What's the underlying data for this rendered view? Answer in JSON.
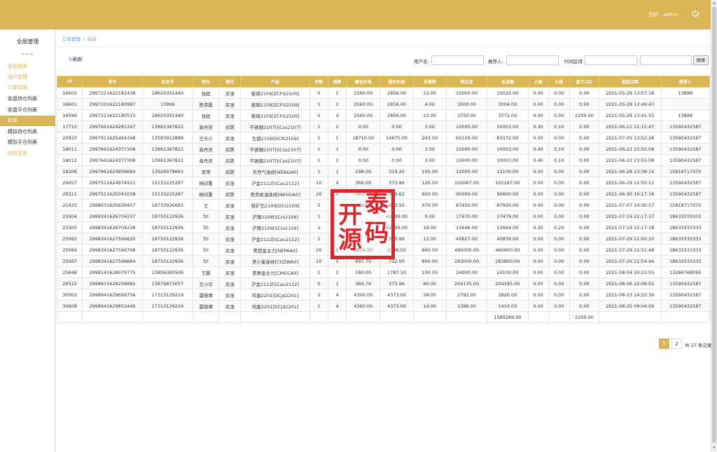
{
  "header": {
    "welcome": "您好：admin",
    "power_icon": "power-icon"
  },
  "sidebar": {
    "title": "全局管理",
    "items": [
      {
        "label": "系统相关",
        "kind": "section"
      },
      {
        "label": "客户管理",
        "kind": "section"
      },
      {
        "label": "订单管理",
        "kind": "section"
      },
      {
        "label": "实盘持仓列表",
        "kind": "sub"
      },
      {
        "label": "实盘平仓列表",
        "kind": "sub"
      },
      {
        "label": "挂单",
        "kind": "active"
      },
      {
        "label": "模拟持仓列表",
        "kind": "sub"
      },
      {
        "label": "模拟平仓列表",
        "kind": "sub"
      },
      {
        "label": "财务管理",
        "kind": "section"
      }
    ]
  },
  "breadcrumb": {
    "parent": "订单管理",
    "separator": "/",
    "current": "挂单"
  },
  "toolbar": {
    "refresh_label": "刷新",
    "username_label": "用户名:",
    "referrer_label": "推荐人:",
    "time_range_label": "时间区域",
    "range_dash": "-",
    "search_label": "搜索"
  },
  "table": {
    "columns": [
      "ID",
      "单号",
      "会员号",
      "姓名",
      "模式",
      "产品",
      "手数",
      "倍数",
      "建仓价格",
      "报价价格",
      "手续费",
      "保证金",
      "总金额",
      "止盈",
      "止损",
      "盈亏(点)",
      "发起日期",
      "推荐人"
    ],
    "rows": [
      [
        "16602",
        "2997221622181438",
        "18620331440",
        "张超",
        "买涨",
        "玻璃2109[ZCFG2109]",
        "5",
        "1",
        "2560.00",
        "2856.00",
        "22.00",
        "15000.00",
        "15022.00",
        "0.00",
        "0.00",
        "0.00",
        "2021-05-28 13:57:18",
        "13888"
      ],
      [
        "16601",
        "2997201622180987",
        "13999",
        "陈伟霞",
        "买涨",
        "玻璃2109[ZCFG2109]",
        "1",
        "1",
        "2560.00",
        "2856.00",
        "4.00",
        "3000.00",
        "3004.00",
        "0.00",
        "0.00",
        "0.00",
        "2021-05-28 13:49:47",
        ""
      ],
      [
        "16599",
        "2997221622180515",
        "18620331440",
        "张超",
        "买涨",
        "玻璃2109[ZCFG2109]",
        "5",
        "4",
        "2560.00",
        "2856.00",
        "22.00",
        "3750.00",
        "3772.00",
        "0.00",
        "0.00",
        "2200.00",
        "2021-05-28 13:41:55",
        "13888"
      ],
      [
        "17710",
        "2997661624281347",
        "13861367822",
        "袁丹庆",
        "买跌",
        "不锈钢2107[SCss2107]",
        "1",
        "1",
        "0.00",
        "0.00",
        "3.00",
        "10000.00",
        "10003.00",
        "0.30",
        "0.10",
        "0.00",
        "2021-06-21 21:15:47",
        "13590432587"
      ],
      [
        "20923",
        "2997911625464348",
        "13583912888",
        "王乐小",
        "买涨",
        "生猪2109[DClh2109]",
        "1",
        "1",
        "18710.00",
        "14675.00",
        "243.00",
        "63129.00",
        "63372.00",
        "0.00",
        "0.00",
        "0.00",
        "2021-07-05 13:52:28",
        "13590432587"
      ],
      [
        "18011",
        "2997661624377308",
        "13861367822",
        "袁丹庆",
        "买跌",
        "不锈钢2107[SCss2107]",
        "1",
        "1",
        "0.00",
        "0.00",
        "3.00",
        "10000.00",
        "10003.00",
        "0.40",
        "0.10",
        "0.00",
        "2021-06-22 23:55:08",
        "13590432587"
      ],
      [
        "18012",
        "2997661624377308",
        "13861367822",
        "袁丹庆",
        "买跌",
        "不锈钢2107[SCss2107]",
        "1",
        "1",
        "0.00",
        "0.00",
        "3.00",
        "10000.00",
        "10003.00",
        "0.40",
        "0.10",
        "0.00",
        "2021-06-22 23:55:08",
        "13590432587"
      ],
      [
        "19206",
        "2997861624858694",
        "13926079663",
        "李萍",
        "买跌",
        "天然气连续[NENGA0]",
        "1",
        "1",
        "298.00",
        "319.20",
        "100.00",
        "12000.00",
        "12100.00",
        "0.00",
        "0.00",
        "0.00",
        "2021-06-28 13:38:14",
        "15818717070"
      ],
      [
        "20057",
        "2997511624974911",
        "15133225287",
        "杨印重",
        "买涨",
        "沪金2112[SCau2112]",
        "10",
        "4",
        "366.00",
        "373.96",
        "120.00",
        "102067.00",
        "102187.00",
        "0.00",
        "0.00",
        "0.00",
        "2021-06-29 21:55:11",
        "13590432587"
      ],
      [
        "20211",
        "2997511625041038",
        "15133225287",
        "杨印重",
        "买跌",
        "美页岩油连续[NEHOA0]",
        "20",
        "4",
        "493.90",
        "473.62",
        "600.00",
        "90000.00",
        "90600.00",
        "0.00",
        "0.00",
        "0.00",
        "2021-06-30 16:17:18",
        "13590432587"
      ],
      [
        "21433",
        "2998031625639457",
        "18733926683",
        "王",
        "买涨",
        "铁矿石2109[DCi2109]",
        "5",
        "",
        "1200",
        "943.50",
        "470.00",
        "87450.00",
        "87920.00",
        "0.00",
        "0.00",
        "0.00",
        "2021-07-07 14:30:57",
        "15818717070"
      ],
      [
        "23304",
        "2998341626704237",
        "18750122936",
        "fzl",
        "买涨",
        "沪镍2109[SCni2109]",
        "1",
        "",
        "",
        "42200.00",
        "9.00",
        "17470.00",
        "17479.00",
        "0.00",
        "0.00",
        "0.00",
        "2021-07-19 22:17:17",
        "18633333333"
      ],
      [
        "23305",
        "2998341626704238",
        "18750122936",
        "fzl",
        "买涨",
        "沪镍2109[SCni2109]",
        "2",
        "",
        "",
        "42200.00",
        "18.00",
        "11646.00",
        "11664.00",
        "0.20",
        "0.20",
        "0.00",
        "2021-07-19 22:17:18",
        "18633333333"
      ],
      [
        "25062",
        "2998341627566620",
        "18750122936",
        "fzl",
        "买涨",
        "沪金2112[SCau2112]",
        "1",
        "",
        "",
        "373.96",
        "12.00",
        "40827.00",
        "40839.00",
        "0.00",
        "0.00",
        "0.00",
        "2021-07-29 21:50:20",
        "18633333333"
      ],
      [
        "25064",
        "2998341627566708",
        "18750122936",
        "fzl",
        "买涨",
        "美钯金主力[NEPAA0]",
        "20",
        "1",
        "2674.50",
        "2396.50",
        "900.00",
        "480000.00",
        "480900.00",
        "0.00",
        "0.00",
        "0.00",
        "2021-07-29 21:51:48",
        "18633333333"
      ],
      [
        "25067",
        "2998341627566884",
        "18750122936",
        "fzl",
        "买涨",
        "美小麦连续[COZWA0]",
        "10",
        "1",
        "697.75",
        "732.00",
        "800.00",
        "283000.00",
        "283800.00",
        "0.00",
        "0.00",
        "0.00",
        "2021-07-29 21:54:44",
        "18633333333"
      ],
      [
        "25848",
        "2998141628079775",
        "13806365508",
        "王鹏",
        "买涨",
        "美黄金主力[CMGCA0]",
        "1",
        "1",
        "180.00",
        "1787.10",
        "100.00",
        "24000.00",
        "24100.00",
        "0.00",
        "0.00",
        "0.00",
        "2021-08-04 20:22:55",
        "13286768095"
      ],
      [
        "26522",
        "2998831628258882",
        "13679873057",
        "王小华",
        "买涨",
        "沪金2112[SCau2112]",
        "5",
        "1",
        "369.76",
        "373.96",
        "60.00",
        "204135.00",
        "204195.00",
        "0.00",
        "0.00",
        "0.00",
        "2021-08-06 22:08:02",
        "13590432587"
      ],
      [
        "30002",
        "2998941629699756",
        "17313129219",
        "雷晓晴",
        "买涨",
        "鸡蛋2201[DCjd2201]",
        "2",
        "4",
        "4300.00",
        "4373.00",
        "28.00",
        "2792.00",
        "2820.00",
        "0.00",
        "0.00",
        "0.00",
        "2021-08-23 14:22:36",
        "13590432587"
      ],
      [
        "30608",
        "2998941629853449",
        "17313129219",
        "雷晓晴",
        "买涨",
        "鸡蛋2201[DCjd2201]",
        "1",
        "4",
        "4360.00",
        "4373.00",
        "14.00",
        "1396.00",
        "1410.00",
        "0.00",
        "0.00",
        "0.00",
        "2021-08-25 09:04:09",
        "13590432587"
      ]
    ],
    "totals": {
      "total_amount": "1589289.00",
      "profit_points": "2200.00"
    }
  },
  "pagination": {
    "pages": [
      "1",
      "2"
    ],
    "current": "1",
    "summary": "共 27 条记录"
  },
  "stamp": {
    "chars": [
      "开",
      "泰",
      "源",
      "码"
    ],
    "color": "#d8282e"
  },
  "colors": {
    "accent": "#d9b555",
    "link": "#5a9bd5"
  }
}
